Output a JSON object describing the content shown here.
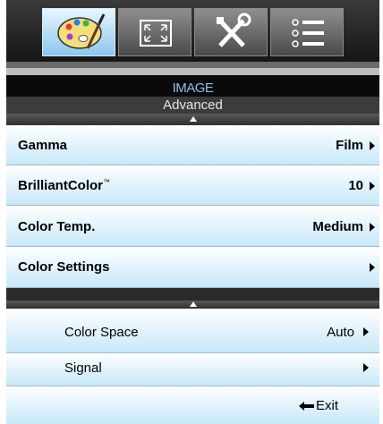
{
  "tabs": [
    {
      "icon": "palette-icon",
      "active": true
    },
    {
      "icon": "fullscreen-icon",
      "active": false
    },
    {
      "icon": "tools-icon",
      "active": false
    },
    {
      "icon": "list-icon",
      "active": false
    }
  ],
  "header": {
    "title": "IMAGE",
    "subtitle": "Advanced"
  },
  "menu": [
    {
      "label": "Gamma",
      "value": "Film"
    },
    {
      "label": "BrilliantColor",
      "trademark": "™",
      "value": "10"
    },
    {
      "label": "Color Temp.",
      "value": "Medium"
    },
    {
      "label": "Color Settings",
      "value": ""
    }
  ],
  "submenu": [
    {
      "label": "Color Space",
      "value": "Auto"
    },
    {
      "label": "Signal",
      "value": ""
    }
  ],
  "footer": {
    "exit_label": "Exit"
  },
  "colors": {
    "accent": "#8ec0ee",
    "active_tab": "#bfe3f7",
    "row": "#dff2fc"
  }
}
